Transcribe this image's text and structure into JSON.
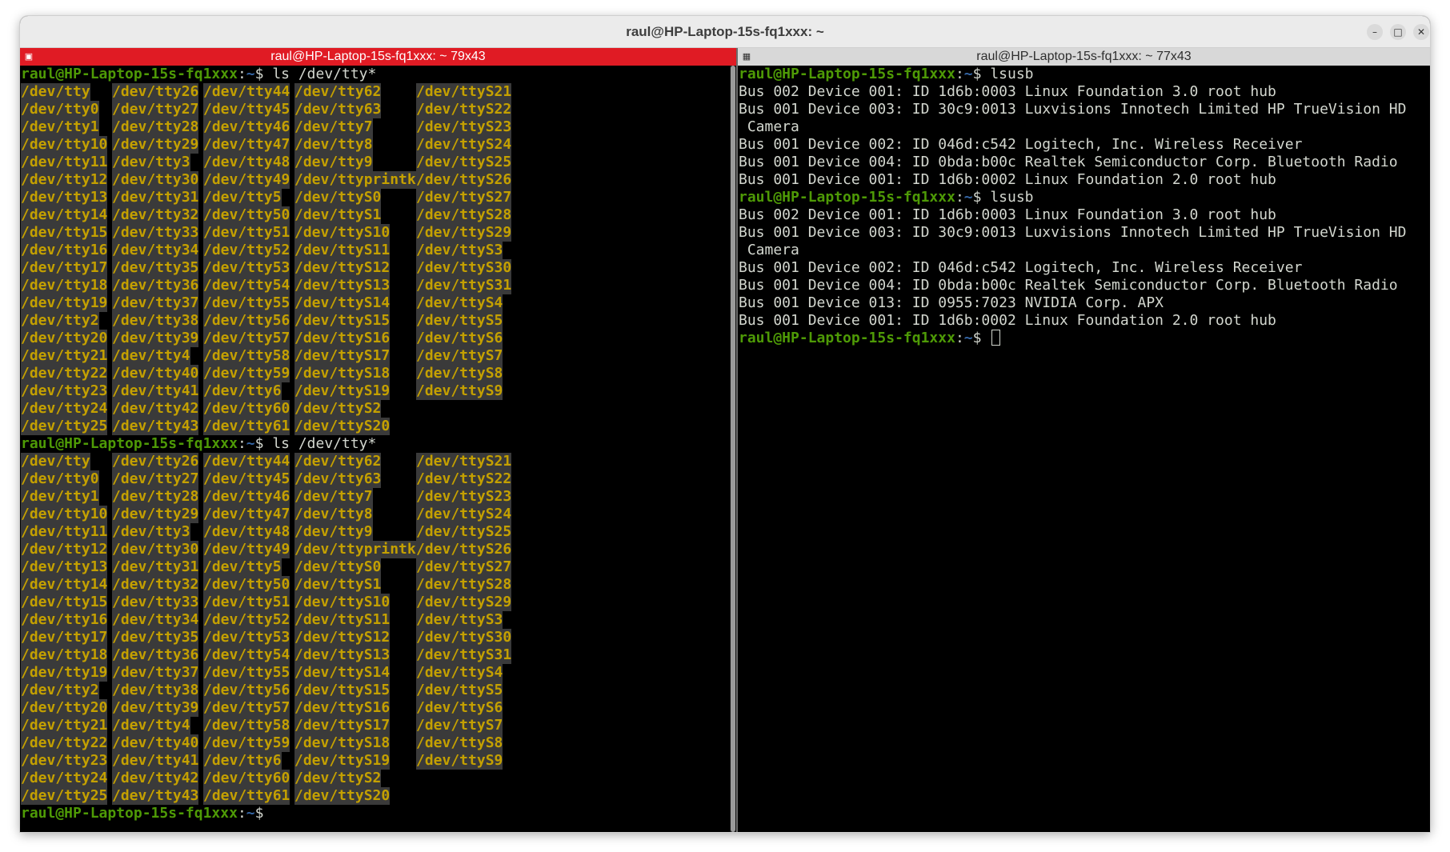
{
  "window": {
    "title": "raul@HP-Laptop-15s-fq1xxx: ~"
  },
  "left_terminal": {
    "tab_title": "raul@HP-Laptop-15s-fq1xxx: ~ 79x43",
    "prompt_user": "raul@HP-Laptop-15s-fq1xxx",
    "prompt_path": "~",
    "command1": "ls /dev/tty*",
    "command2": "ls /dev/tty*",
    "columns": [
      [
        "/dev/tty",
        "/dev/tty0",
        "/dev/tty1",
        "/dev/tty10",
        "/dev/tty11",
        "/dev/tty12",
        "/dev/tty13",
        "/dev/tty14",
        "/dev/tty15",
        "/dev/tty16",
        "/dev/tty17",
        "/dev/tty18",
        "/dev/tty19",
        "/dev/tty2",
        "/dev/tty20",
        "/dev/tty21",
        "/dev/tty22",
        "/dev/tty23",
        "/dev/tty24",
        "/dev/tty25"
      ],
      [
        "/dev/tty26",
        "/dev/tty27",
        "/dev/tty28",
        "/dev/tty29",
        "/dev/tty3",
        "/dev/tty30",
        "/dev/tty31",
        "/dev/tty32",
        "/dev/tty33",
        "/dev/tty34",
        "/dev/tty35",
        "/dev/tty36",
        "/dev/tty37",
        "/dev/tty38",
        "/dev/tty39",
        "/dev/tty4",
        "/dev/tty40",
        "/dev/tty41",
        "/dev/tty42",
        "/dev/tty43"
      ],
      [
        "/dev/tty44",
        "/dev/tty45",
        "/dev/tty46",
        "/dev/tty47",
        "/dev/tty48",
        "/dev/tty49",
        "/dev/tty5",
        "/dev/tty50",
        "/dev/tty51",
        "/dev/tty52",
        "/dev/tty53",
        "/dev/tty54",
        "/dev/tty55",
        "/dev/tty56",
        "/dev/tty57",
        "/dev/tty58",
        "/dev/tty59",
        "/dev/tty6",
        "/dev/tty60",
        "/dev/tty61"
      ],
      [
        "/dev/tty62",
        "/dev/tty63",
        "/dev/tty7",
        "/dev/tty8",
        "/dev/tty9",
        "/dev/ttyprintk",
        "/dev/ttyS0",
        "/dev/ttyS1",
        "/dev/ttyS10",
        "/dev/ttyS11",
        "/dev/ttyS12",
        "/dev/ttyS13",
        "/dev/ttyS14",
        "/dev/ttyS15",
        "/dev/ttyS16",
        "/dev/ttyS17",
        "/dev/ttyS18",
        "/dev/ttyS19",
        "/dev/ttyS2",
        "/dev/ttyS20"
      ],
      [
        "/dev/ttyS21",
        "/dev/ttyS22",
        "/dev/ttyS23",
        "/dev/ttyS24",
        "/dev/ttyS25",
        "/dev/ttyS26",
        "/dev/ttyS27",
        "/dev/ttyS28",
        "/dev/ttyS29",
        "/dev/ttyS3",
        "/dev/ttyS30",
        "/dev/ttyS31",
        "/dev/ttyS4",
        "/dev/ttyS5",
        "/dev/ttyS6",
        "/dev/ttyS7",
        "/dev/ttyS8",
        "/dev/ttyS9"
      ]
    ]
  },
  "right_terminal": {
    "tab_title": "raul@HP-Laptop-15s-fq1xxx: ~ 77x43",
    "prompt_user": "raul@HP-Laptop-15s-fq1xxx",
    "prompt_path": "~",
    "blocks": [
      {
        "command": "lsusb",
        "output": [
          "Bus 002 Device 001: ID 1d6b:0003 Linux Foundation 3.0 root hub",
          "Bus 001 Device 003: ID 30c9:0013 Luxvisions Innotech Limited HP TrueVision HD",
          " Camera",
          "Bus 001 Device 002: ID 046d:c542 Logitech, Inc. Wireless Receiver",
          "Bus 001 Device 004: ID 0bda:b00c Realtek Semiconductor Corp. Bluetooth Radio",
          "Bus 001 Device 001: ID 1d6b:0002 Linux Foundation 2.0 root hub"
        ]
      },
      {
        "command": "lsusb",
        "output": [
          "Bus 002 Device 001: ID 1d6b:0003 Linux Foundation 3.0 root hub",
          "Bus 001 Device 003: ID 30c9:0013 Luxvisions Innotech Limited HP TrueVision HD",
          " Camera",
          "Bus 001 Device 002: ID 046d:c542 Logitech, Inc. Wireless Receiver",
          "Bus 001 Device 004: ID 0bda:b00c Realtek Semiconductor Corp. Bluetooth Radio",
          "Bus 001 Device 013: ID 0955:7023 NVIDIA Corp. APX",
          "Bus 001 Device 001: ID 1d6b:0002 Linux Foundation 2.0 root hub"
        ]
      }
    ]
  },
  "colors": {
    "active_tab": "#e01b24",
    "prompt_green": "#4e9a06",
    "path_blue": "#3465a4",
    "device_yellow": "#c4a000",
    "device_bg": "#3a3a3a"
  },
  "icons": {
    "window_minimize": "minimize-icon",
    "window_maximize": "maximize-icon",
    "window_close": "close-icon",
    "left_tab": "terminal-split-icon",
    "right_tab": "terminal-split-icon"
  }
}
